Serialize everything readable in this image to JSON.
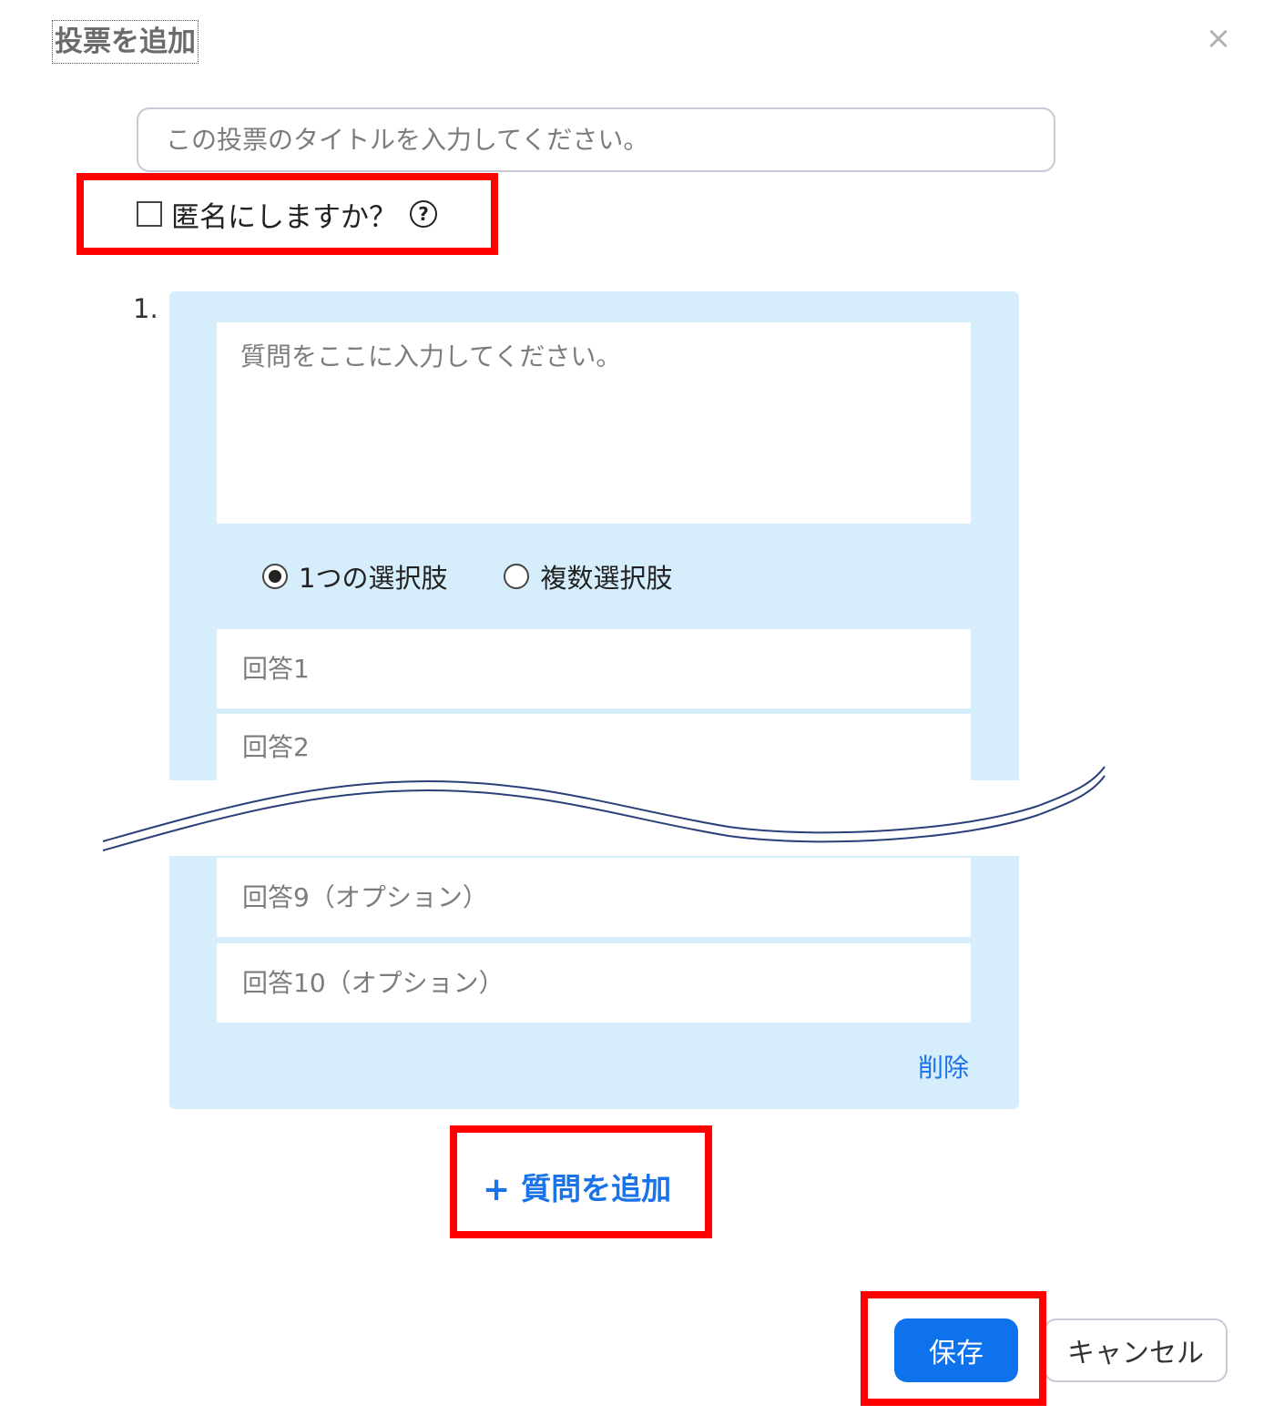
{
  "dialog": {
    "title": "投票を追加",
    "close_glyph": "×"
  },
  "poll_title": {
    "placeholder": "この投票のタイトルを入力してください。",
    "value": ""
  },
  "anonymous": {
    "label": "匿名にしますか？",
    "checked": false,
    "help_glyph": "?"
  },
  "question": {
    "number": "1.",
    "placeholder": "質問をここに入力してください。",
    "choice_types": [
      {
        "label": "1つの選択肢",
        "selected": true
      },
      {
        "label": "複数選択肢",
        "selected": false
      }
    ],
    "answers": [
      {
        "placeholder": "回答1"
      },
      {
        "placeholder": "回答2"
      },
      {
        "placeholder": "回答9（オプション）"
      },
      {
        "placeholder": "回答10（オプション）"
      }
    ],
    "delete_label": "削除"
  },
  "add_question": {
    "plus": "+",
    "label": "質問を追加"
  },
  "buttons": {
    "save": "保存",
    "cancel": "キャンセル"
  },
  "colors": {
    "accent": "#0e72ed",
    "link": "#1a73e8",
    "panel": "#d6eefc",
    "annotation": "#ff0000",
    "break_line": "#2b3f7a"
  }
}
